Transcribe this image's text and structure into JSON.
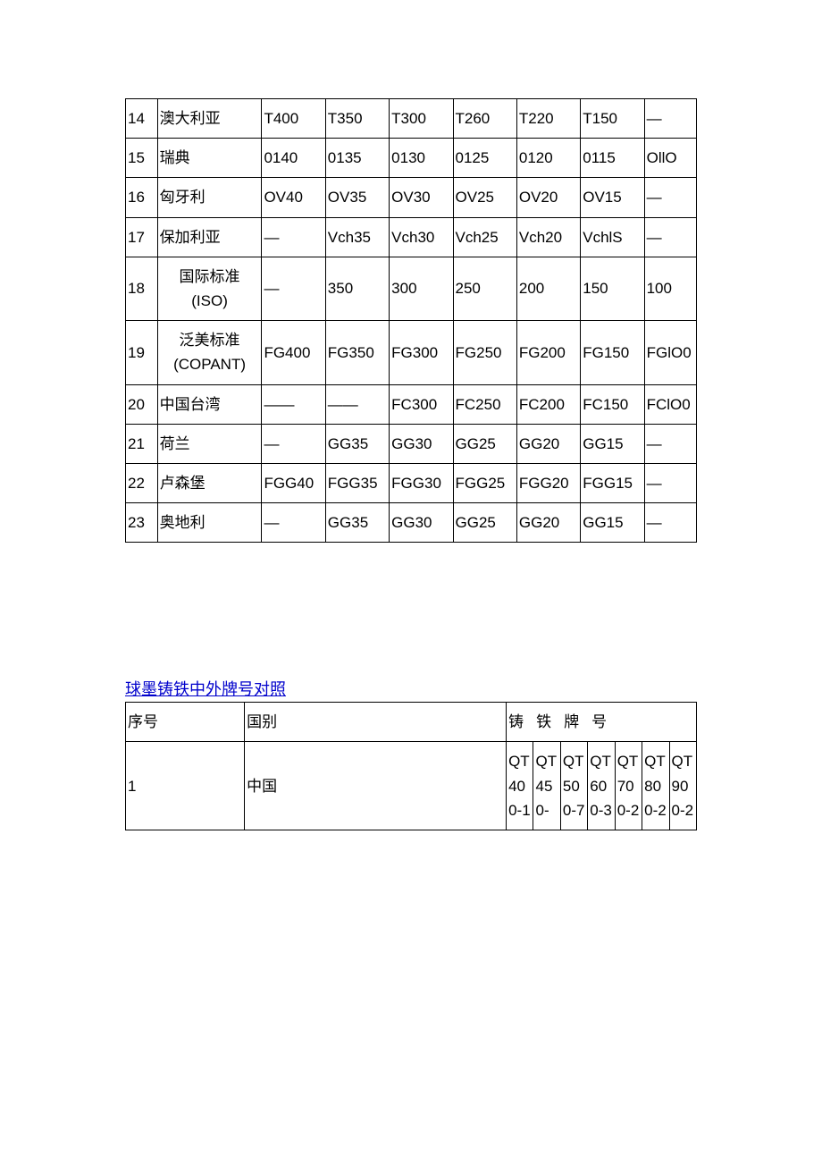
{
  "table1": {
    "rows": [
      {
        "no": "14",
        "country": "澳大利亚",
        "c": [
          "T400",
          "T350",
          "T300",
          "T260",
          "T220",
          "T150",
          "—"
        ],
        "tall": false,
        "centered": false
      },
      {
        "no": "15",
        "country": "瑞典",
        "c": [
          "0140",
          "0135",
          "0130",
          "0125",
          "0120",
          "0115",
          "OllO"
        ],
        "tall": false,
        "centered": false
      },
      {
        "no": "16",
        "country": "匈牙利",
        "c": [
          "OV40",
          "OV35",
          "OV30",
          "OV25",
          "OV20",
          "OV15",
          "—"
        ],
        "tall": false,
        "centered": false
      },
      {
        "no": "17",
        "country": "保加利亚",
        "c": [
          "—",
          "Vch35",
          "Vch30",
          "Vch25",
          "Vch20",
          "VchlS",
          "—"
        ],
        "tall": false,
        "centered": false
      },
      {
        "no": "18",
        "country": "国际标准 (ISO)",
        "c": [
          "—",
          "350",
          "300",
          "250",
          "200",
          "150",
          "100"
        ],
        "tall": true,
        "centered": true
      },
      {
        "no": "19",
        "country": "泛美标准 (COPANT)",
        "c": [
          "FG400",
          "FG350",
          "FG300",
          "FG250",
          "FG200",
          "FG150",
          "FGlO0"
        ],
        "tall": true,
        "centered": true
      },
      {
        "no": "20",
        "country": "中国台湾",
        "c": [
          "——",
          "——",
          "FC300",
          "FC250",
          "FC200",
          "FC150",
          "FClO0"
        ],
        "tall": false,
        "centered": false
      },
      {
        "no": "21",
        "country": "荷兰",
        "c": [
          "—",
          "GG35",
          "GG30",
          "GG25",
          "GG20",
          "GG15",
          "—"
        ],
        "tall": false,
        "centered": false
      },
      {
        "no": "22",
        "country": "卢森堡",
        "c": [
          "FGG40",
          "FGG35",
          "FGG30",
          "FGG25",
          "FGG20",
          "FGG15",
          "—"
        ],
        "tall": false,
        "centered": false
      },
      {
        "no": "23",
        "country": "奥地利",
        "c": [
          "—",
          "GG35",
          "GG30",
          "GG25",
          "GG20",
          "GG15",
          "—"
        ],
        "tall": false,
        "centered": false
      }
    ]
  },
  "section2_title": "球墨铸铁中外牌号对照",
  "table2": {
    "header": {
      "seq": "序号",
      "country": "国别",
      "grades_label": "铸铁牌号"
    },
    "row1": {
      "no": "1",
      "country": "中国",
      "c": [
        "QT400-1",
        "QT450-",
        "QT500-7",
        "QT600-3",
        "QT700-2",
        "QT800-2",
        "QT900-2"
      ]
    }
  }
}
